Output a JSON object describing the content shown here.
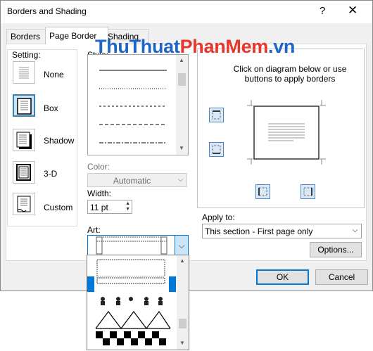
{
  "window": {
    "title": "Borders and Shading",
    "help": "?",
    "close": "✕"
  },
  "tabs": [
    {
      "label": "Borders"
    },
    {
      "label": "Page Border"
    },
    {
      "label": "Shading"
    }
  ],
  "setting": {
    "label": "Setting:",
    "options": [
      {
        "label": "None"
      },
      {
        "label": "Box"
      },
      {
        "label": "Shadow"
      },
      {
        "label": "3-D"
      },
      {
        "label": "Custom"
      }
    ],
    "selected": "Box"
  },
  "style": {
    "label": "Style:"
  },
  "color": {
    "label": "Color:",
    "value": "Automatic"
  },
  "width": {
    "label": "Width:",
    "value": "11 pt"
  },
  "art": {
    "label": "Art:"
  },
  "preview": {
    "label": "Preview",
    "instructions": "Click on diagram below or use buttons to apply borders"
  },
  "apply_to": {
    "label": "Apply to:",
    "value": "This section - First page only"
  },
  "buttons": {
    "options": "Options...",
    "ok": "OK",
    "cancel": "Cancel"
  },
  "watermark": {
    "part1": "ThuThuat",
    "part2": "PhanMem",
    "part3": ".vn",
    "color1": "#1f64c8",
    "color2": "#e8362d"
  }
}
